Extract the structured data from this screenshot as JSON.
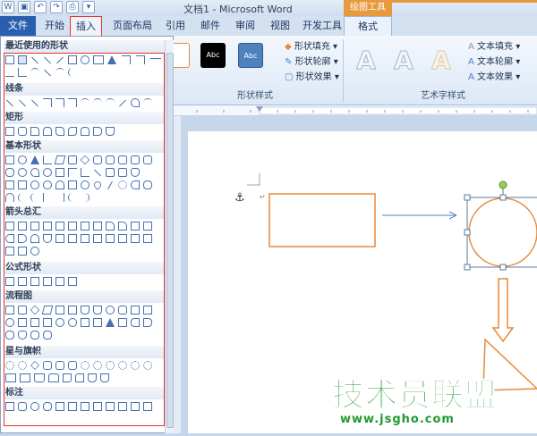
{
  "title_bar": {
    "document_title": "文档1 - Microsoft Word",
    "contextual_tab_title": "绘图工具"
  },
  "tabs": {
    "file": "文件",
    "home": "开始",
    "insert": "插入",
    "page_layout": "页面布局",
    "references": "引用",
    "mailings": "邮件",
    "review": "审阅",
    "view": "视图",
    "developer": "开发工具",
    "format": "格式"
  },
  "ribbon": {
    "shape_styles_group": "形状样式",
    "wordart_styles_group": "艺术字样式",
    "shape_fill": "形状填充",
    "shape_outline": "形状轮廓",
    "shape_effects": "形状效果",
    "text_fill": "文本填充",
    "text_outline": "文本轮廓",
    "text_effects": "文本效果",
    "swatch_1": "Abc",
    "swatch_2": "Abc",
    "swatch_3": "Abc",
    "wordart_glyph": "A"
  },
  "shapes_panel": {
    "categories": {
      "recent": "最近使用的形状",
      "lines": "线条",
      "rectangles": "矩形",
      "basic": "基本形状",
      "arrows": "箭头总汇",
      "equation": "公式形状",
      "flowchart": "流程图",
      "stars": "星与旗帜",
      "callouts": "标注"
    }
  },
  "watermark": {
    "title": "技术员联盟",
    "url": "www.jsgho.com"
  },
  "colors": {
    "accent_orange": "#e8893a",
    "arrow_blue": "#4a7fc7",
    "highlight_red": "#e8312c",
    "file_tab_blue": "#2a5fb0",
    "watermark_green": "#1f9a2e"
  }
}
